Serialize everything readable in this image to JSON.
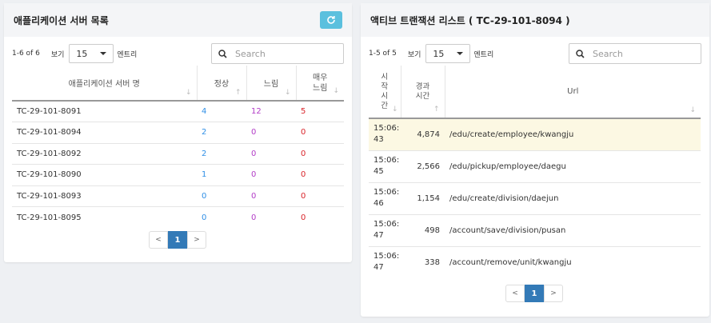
{
  "left": {
    "title": "애플리케이션 서버 목록",
    "range": "1-6 of 6",
    "show_label": "보기",
    "page_size": "15",
    "entries_label": "엔트리",
    "search_placeholder": "Search",
    "columns": [
      "애플리케이션 서버 명",
      "정상",
      "느림",
      "매우\n느림"
    ],
    "rows": [
      {
        "name": "TC-29-101-8091",
        "normal": "4",
        "slow": "12",
        "very_slow": "5"
      },
      {
        "name": "TC-29-101-8094",
        "normal": "2",
        "slow": "0",
        "very_slow": "0"
      },
      {
        "name": "TC-29-101-8092",
        "normal": "2",
        "slow": "0",
        "very_slow": "0"
      },
      {
        "name": "TC-29-101-8090",
        "normal": "1",
        "slow": "0",
        "very_slow": "0"
      },
      {
        "name": "TC-29-101-8093",
        "normal": "0",
        "slow": "0",
        "very_slow": "0"
      },
      {
        "name": "TC-29-101-8095",
        "normal": "0",
        "slow": "0",
        "very_slow": "0"
      }
    ],
    "pager": {
      "prev": "<",
      "current": "1",
      "next": ">"
    }
  },
  "right": {
    "title": "액티브 트랜잭션 리스트 ( TC-29-101-8094 )",
    "range": "1-5 of 5",
    "show_label": "보기",
    "page_size": "15",
    "entries_label": "엔트리",
    "search_placeholder": "Search",
    "columns": [
      "시\n작\n시\n간",
      "경과\n시간",
      "Url"
    ],
    "rows": [
      {
        "time": "15:06:\n43",
        "elapsed": "4,874",
        "url": "/edu/create/employee/kwangju"
      },
      {
        "time": "15:06:\n45",
        "elapsed": "2,566",
        "url": "/edu/pickup/employee/daegu"
      },
      {
        "time": "15:06:\n46",
        "elapsed": "1,154",
        "url": "/edu/create/division/daejun"
      },
      {
        "time": "15:06:\n47",
        "elapsed": "498",
        "url": "/account/save/division/pusan"
      },
      {
        "time": "15:06:\n47",
        "elapsed": "338",
        "url": "/account/remove/unit/kwangju"
      }
    ],
    "pager": {
      "prev": "<",
      "current": "1",
      "next": ">"
    }
  },
  "colors": {
    "accent": "#337ab7",
    "refresh": "#5bc0de",
    "normal": "#2f8fe6",
    "slow": "#b23cc7",
    "very_slow": "#d9242a",
    "highlight_row": "#fcf8e3"
  }
}
